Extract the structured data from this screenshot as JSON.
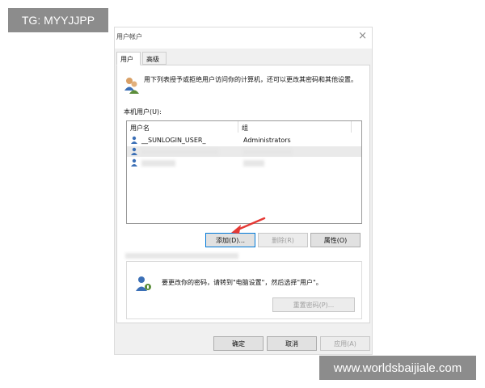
{
  "watermarks": {
    "top": "TG: MYYJJPP",
    "bottom": "www.worldsbaijiale.com"
  },
  "dialog": {
    "title": "用户帐户",
    "close_glyph": "×"
  },
  "tabs": [
    {
      "label": "用户",
      "active": true
    },
    {
      "label": "高级",
      "active": false
    }
  ],
  "panel": {
    "description": "用下列表授予或拒绝用户访问你的计算机，还可以更改其密码和其他设置。",
    "local_users_label": "本机用户(U):"
  },
  "user_list": {
    "columns": [
      "用户名",
      "组"
    ],
    "rows": [
      {
        "name": "__SUNLOGIN_USER_",
        "group": "Administrators"
      }
    ]
  },
  "buttons": {
    "add": "添加(D)...",
    "remove": "删除(R)",
    "properties": "属性(O)",
    "reset_password": "重置密码(P)...",
    "ok": "确定",
    "cancel": "取消",
    "apply": "应用(A)"
  },
  "password_group": {
    "text": "要更改你的密码，请转到\"电脑设置\"，然后选择\"用户\"。"
  },
  "colors": {
    "annotation_arrow": "#e53935",
    "focus_border": "#0078d7"
  }
}
